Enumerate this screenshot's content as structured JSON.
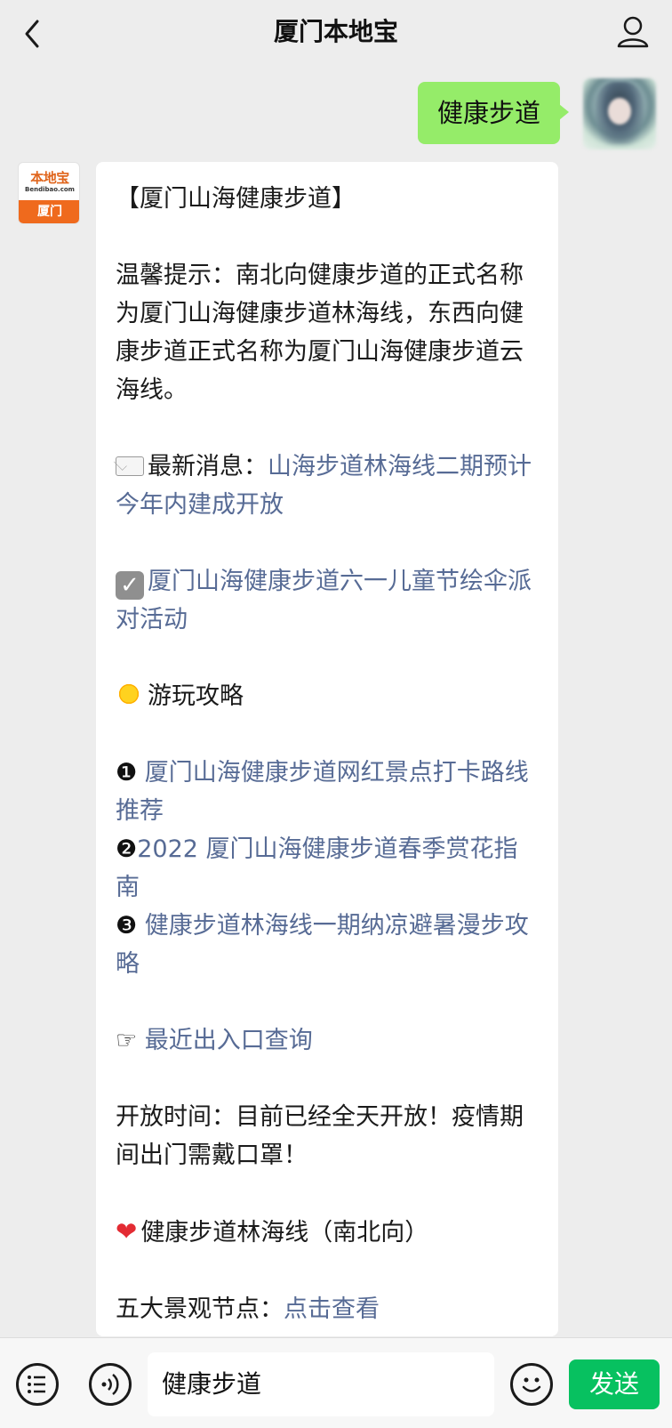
{
  "header": {
    "title": "厦门本地宝"
  },
  "outgoing": {
    "text": "健康步道"
  },
  "bot": {
    "logo_top": "本地宝",
    "logo_sub": "Bendibao.com",
    "logo_city": "厦门"
  },
  "reply": {
    "heading": "【厦门山海健康步道】",
    "tip": "温馨提示：南北向健康步道的正式名称为厦门山海健康步道林海线，东西向健康步道正式名称为厦门山海健康步道云海线。",
    "news_label": "最新消息：",
    "news_link": "山海步道林海线二期预计今年内建成开放",
    "event_link": "厦门山海健康步道六一儿童节绘伞派对活动",
    "guide_title": "游玩攻略",
    "guides": [
      {
        "num": "❶",
        "text": " 厦门山海健康步道网红景点打卡路线推荐"
      },
      {
        "num": "❷",
        "text": "2022 厦门山海健康步道春季赏花指南"
      },
      {
        "num": "❸",
        "text": " 健康步道林海线一期纳凉避暑漫步攻略"
      }
    ],
    "entrance_pointer": "☞",
    "entrance_link": " 最近出入口查询",
    "open_hours": "开放时间：目前已经全天开放！疫情期间出门需戴口罩！",
    "route_title": "健康步道林海线（南北向）",
    "nodes_label": "五大景观节点：",
    "nodes_link": "点击查看"
  },
  "input": {
    "value": "健康步道",
    "send_label": "发送"
  },
  "icons": {
    "back": "chevron-left-icon",
    "profile": "person-icon",
    "menu": "list-icon",
    "voice": "voice-icon",
    "emoji": "smiley-icon"
  },
  "colors": {
    "outgoing_bubble": "#95ec69",
    "link": "#576b95",
    "send_button": "#07c160"
  }
}
